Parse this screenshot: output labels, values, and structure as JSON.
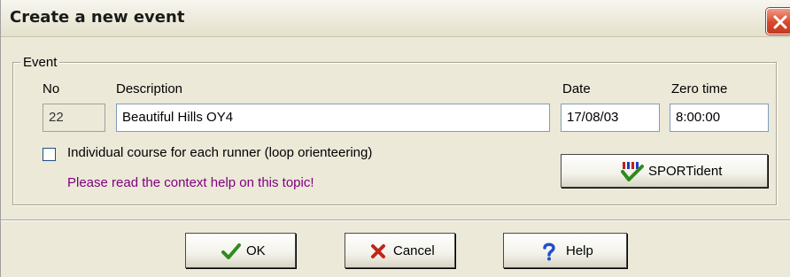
{
  "window": {
    "title": "Create a new event",
    "close_icon": "close-icon"
  },
  "event_group": {
    "legend": "Event",
    "no_label": "No",
    "no_value": "22",
    "description_label": "Description",
    "description_value": "Beautiful Hills OY4",
    "date_label": "Date",
    "date_value": "17/08/03",
    "zero_time_label": "Zero time",
    "zero_time_value": "8:00:00",
    "loop_checkbox_label": "Individual course for each runner (loop orienteering)",
    "loop_checkbox_checked": false,
    "help_note": "Please read the context help on this topic!",
    "sportident_label": "SPORTident",
    "sportident_icon": "sportident-icon"
  },
  "buttons": {
    "ok_label": "OK",
    "ok_icon": "checkmark-icon",
    "cancel_label": "Cancel",
    "cancel_icon": "x-icon",
    "help_label": "Help",
    "help_icon": "question-icon"
  },
  "colors": {
    "help_note": "#800080",
    "ok_check": "#2e8b1e",
    "cancel_x": "#c0251a",
    "help_question": "#1f4fd0"
  }
}
